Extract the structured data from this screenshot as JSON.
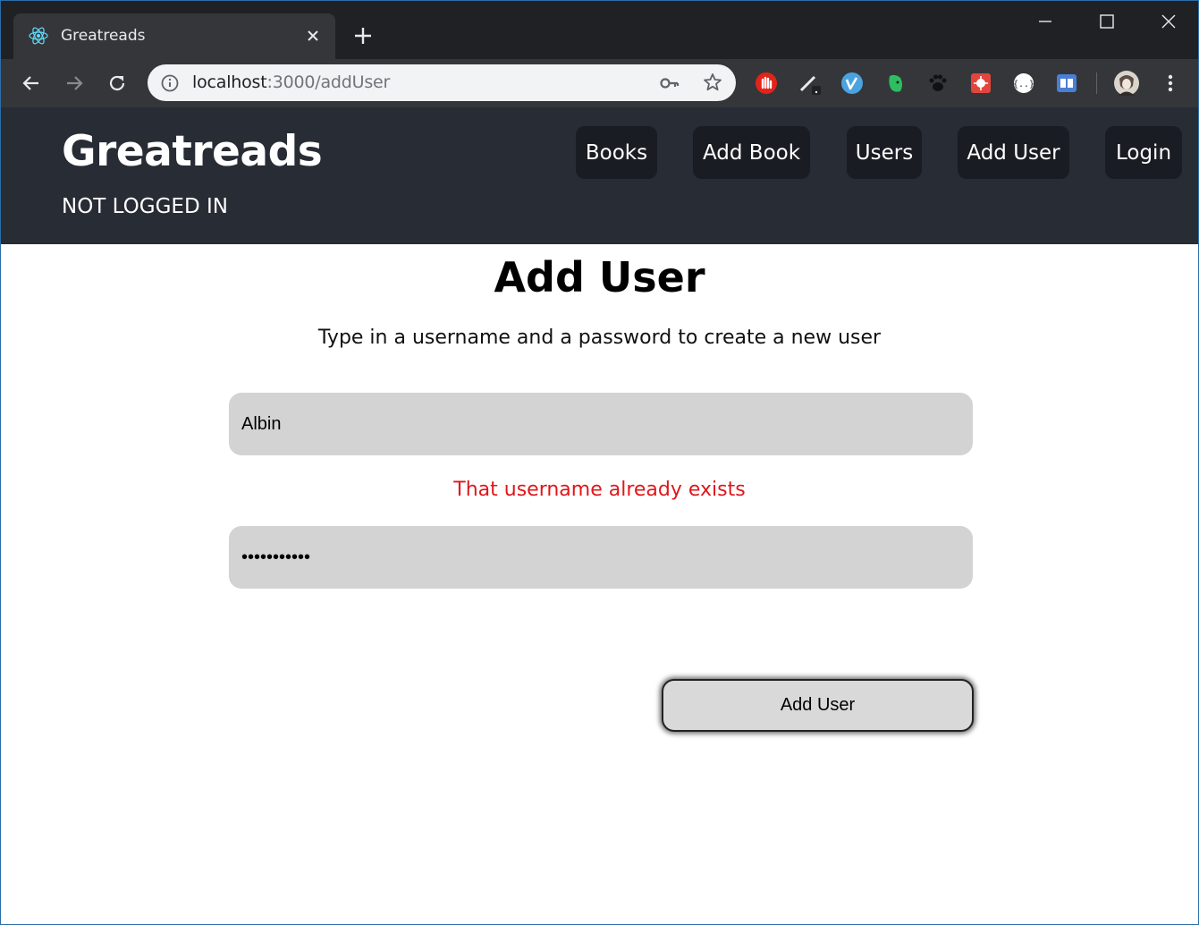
{
  "browser": {
    "tab_title": "Greatreads",
    "url_host": "localhost",
    "url_path": ":3000/addUser"
  },
  "header": {
    "brand": "Greatreads",
    "login_status": "NOT LOGGED IN",
    "nav": {
      "books": "Books",
      "add_book": "Add Book",
      "users": "Users",
      "add_user": "Add User",
      "login": "Login"
    }
  },
  "main": {
    "title": "Add User",
    "subtitle": "Type in a username and a password to create a new user",
    "username_value": "Albin",
    "error_message": "That username already exists",
    "password_value": "•••••••••••",
    "submit_label": "Add User"
  },
  "colors": {
    "header_bg": "#282c34",
    "nav_pill_bg": "#191c22",
    "input_bg": "#d3d3d3",
    "error_text": "#e0161a"
  }
}
